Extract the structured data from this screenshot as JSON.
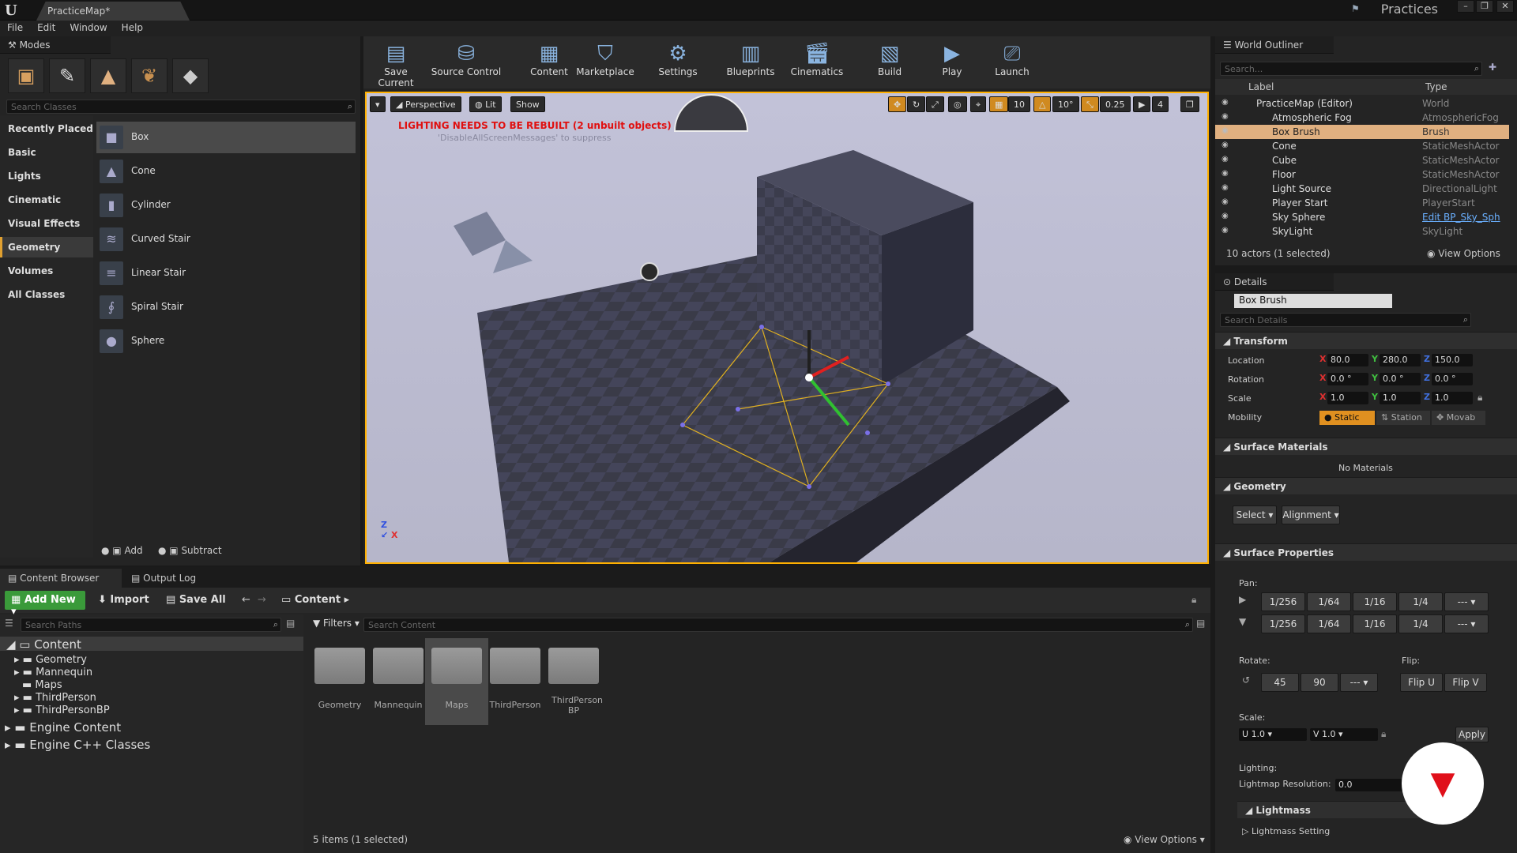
{
  "window": {
    "tab_title": "PracticeMap*",
    "project": "Practices"
  },
  "menu": [
    "File",
    "Edit",
    "Window",
    "Help"
  ],
  "modes": {
    "title": "Modes",
    "search_placeholder": "Search Classes",
    "categories": [
      "Recently Placed",
      "Basic",
      "Lights",
      "Cinematic",
      "Visual Effects",
      "Geometry",
      "Volumes",
      "All Classes"
    ],
    "selected_category": "Geometry",
    "items": [
      "Box",
      "Cone",
      "Cylinder",
      "Curved Stair",
      "Linear Stair",
      "Spiral Stair",
      "Sphere"
    ],
    "selected_item": "Box",
    "add_label": "Add",
    "subtract_label": "Subtract"
  },
  "toolbar": {
    "buttons": [
      "Save Current",
      "Source Control",
      "Content",
      "Marketplace",
      "Settings",
      "Blueprints",
      "Cinematics",
      "Build",
      "Play",
      "Launch"
    ]
  },
  "viewport": {
    "perspective": "Perspective",
    "lit": "Lit",
    "show": "Show",
    "warning": "LIGHTING NEEDS TO BE REBUILT (2 unbuilt objects)",
    "suppress": "'DisableAllScreenMessages' to suppress",
    "grid": "10",
    "rot": "10°",
    "scale": "0.25",
    "cam": "4"
  },
  "outliner": {
    "title": "World Outliner",
    "search_placeholder": "Search...",
    "col_label": "Label",
    "col_type": "Type",
    "rows": [
      {
        "name": "PracticeMap (Editor)",
        "type": "World"
      },
      {
        "name": "Atmospheric Fog",
        "type": "AtmosphericFog"
      },
      {
        "name": "Box Brush",
        "type": "Brush"
      },
      {
        "name": "Cone",
        "type": "StaticMeshActor"
      },
      {
        "name": "Cube",
        "type": "StaticMeshActor"
      },
      {
        "name": "Floor",
        "type": "StaticMeshActor"
      },
      {
        "name": "Light Source",
        "type": "DirectionalLight"
      },
      {
        "name": "Player Start",
        "type": "PlayerStart"
      },
      {
        "name": "Sky Sphere",
        "type": "Edit BP_Sky_Sph"
      },
      {
        "name": "SkyLight",
        "type": "SkyLight"
      }
    ],
    "selected": "Box Brush",
    "status": "10 actors (1 selected)",
    "view_options": "View Options"
  },
  "details": {
    "title": "Details",
    "name": "Box Brush",
    "search_placeholder": "Search Details",
    "transform": "Transform",
    "location": {
      "label": "Location",
      "x": "80.0",
      "y": "280.0",
      "z": "150.0"
    },
    "rotation": {
      "label": "Rotation",
      "x": "0.0 °",
      "y": "0.0 °",
      "z": "0.0 °"
    },
    "scale": {
      "label": "Scale",
      "x": "1.0",
      "y": "1.0",
      "z": "1.0"
    },
    "mobility": {
      "label": "Mobility",
      "options": [
        "Static",
        "Station",
        "Movab"
      ]
    },
    "surface_materials": "Surface Materials",
    "no_materials": "No Materials",
    "geometry": "Geometry",
    "select": "Select",
    "alignment": "Alignment",
    "surface_properties": "Surface Properties",
    "pan": "Pan:",
    "pan_values": [
      "1/256",
      "1/64",
      "1/16",
      "1/4",
      "---"
    ],
    "rotate": "Rotate:",
    "rotate_values": [
      "45",
      "90",
      "---"
    ],
    "flip": "Flip:",
    "flip_u": "Flip U",
    "flip_v": "Flip V",
    "scale_label": "Scale:",
    "u": "U",
    "v": "V",
    "u_val": "1.0",
    "v_val": "1.0",
    "apply": "Apply",
    "lighting": "Lighting:",
    "lightmap": "Lightmap Resolution:",
    "lightmap_val": "0.0",
    "lightmass": "Lightmass",
    "lightmass_settings": "Lightmass Setting"
  },
  "content_browser": {
    "tabs": [
      "Content Browser",
      "Output Log"
    ],
    "add_new": "Add New",
    "import": "Import",
    "save_all": "Save All",
    "path": "Content",
    "search_paths": "Search Paths",
    "filters": "Filters",
    "search_content": "Search Content",
    "tree_root": "Content",
    "tree": [
      "Geometry",
      "Mannequin",
      "Maps",
      "ThirdPerson",
      "ThirdPersonBP"
    ],
    "engine_content": "Engine Content",
    "engine_cpp": "Engine C++ Classes",
    "folders": [
      "Geometry",
      "Mannequin",
      "Maps",
      "ThirdPerson",
      "ThirdPerson BP"
    ],
    "selected_folder": "Maps",
    "status": "5 items (1 selected)",
    "view_options": "View Options"
  }
}
